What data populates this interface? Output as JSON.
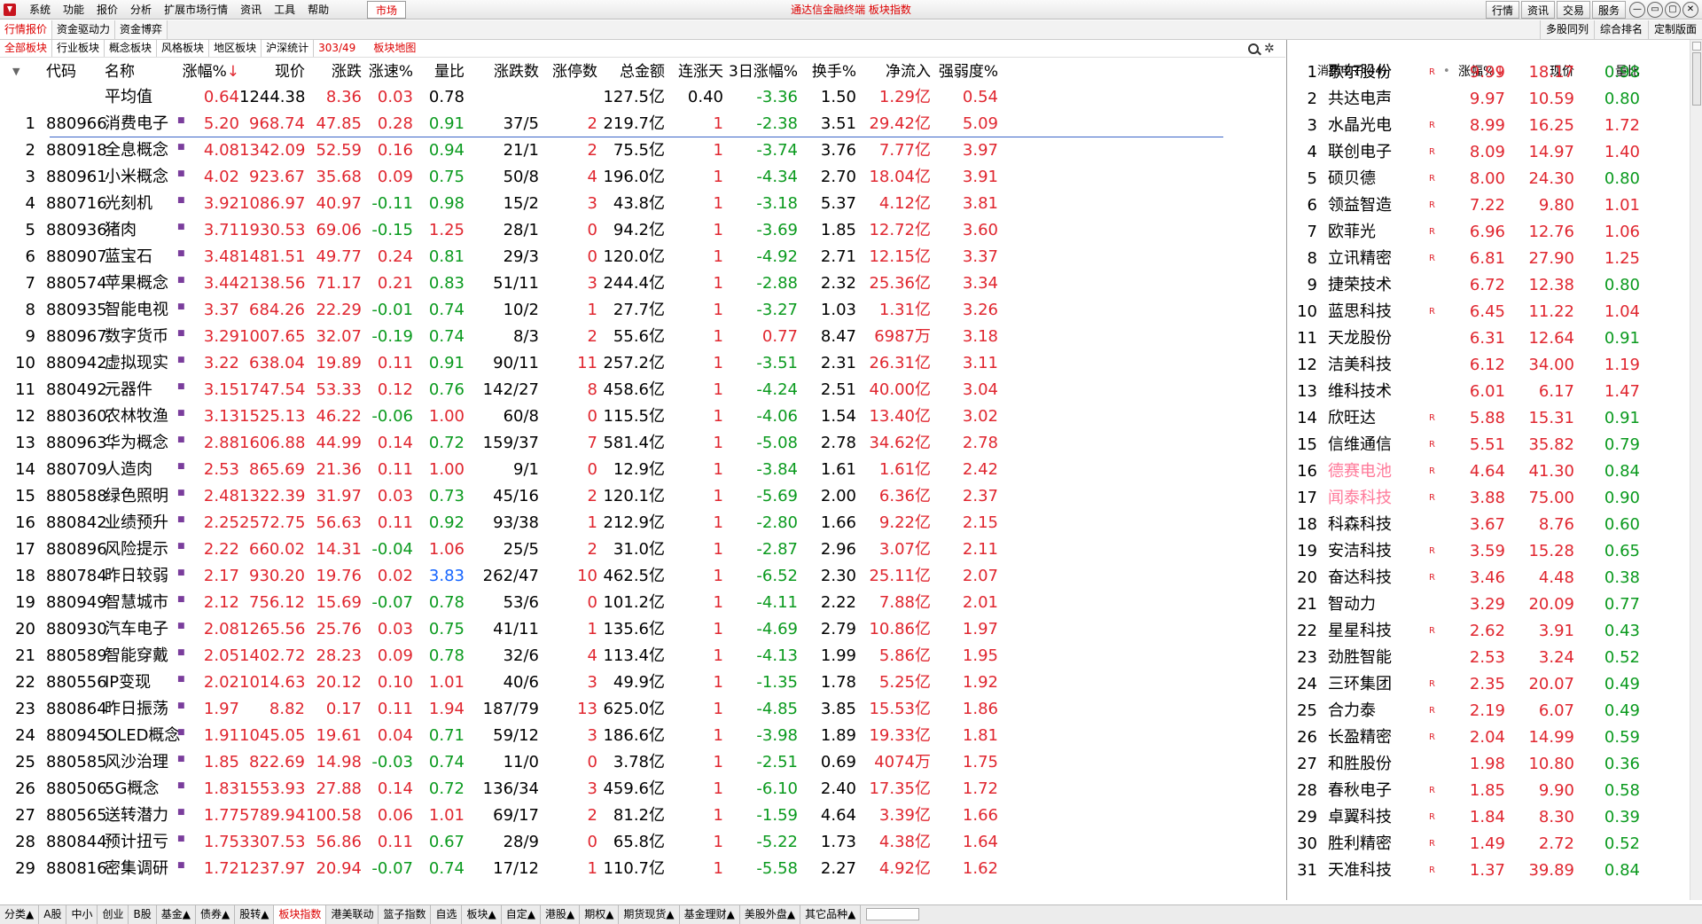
{
  "window": {
    "menu": [
      "系统",
      "功能",
      "报价",
      "分析",
      "扩展市场行情",
      "资讯",
      "工具",
      "帮助"
    ],
    "market_button": "市场",
    "title": "通达信金融终端 板块指数",
    "right_buttons": [
      "行情",
      "资讯",
      "交易",
      "服务"
    ],
    "win_controls": [
      "—",
      "▭",
      "▢",
      "✕"
    ]
  },
  "tabs_top": {
    "left": [
      "行情报价",
      "资金驱动力",
      "资金博弈"
    ],
    "right": [
      "多股同列",
      "综合排名",
      "定制版面"
    ]
  },
  "tabs_sector": [
    "全部板块",
    "行业板块",
    "概念板块",
    "风格板块",
    "地区板块",
    "沪深统计"
  ],
  "sector_count": "303/49",
  "sector_map": "板块地图",
  "left_headers": [
    "代码",
    "名称",
    "涨幅%",
    "现价",
    "涨跌",
    "涨速%",
    "量比",
    "涨跌数",
    "涨停数",
    "总金额",
    "连涨天",
    "3日涨幅%",
    "换手%",
    "净流入",
    "强弱度%"
  ],
  "avg_row": {
    "label": "平均值",
    "vals": [
      "0.64",
      "1244.38",
      "8.36",
      "0.03",
      "0.78",
      "",
      "",
      "127.5亿",
      "0.40",
      "-3.36",
      "1.50",
      "1.29亿",
      "0.54"
    ]
  },
  "rows": [
    [
      "1",
      "880966",
      "消费电子",
      "5.20",
      "968.74",
      "47.85",
      "0.28",
      "0.91",
      "37/5",
      "2",
      "219.7亿",
      "1",
      "-2.38",
      "3.51",
      "29.42亿",
      "5.09"
    ],
    [
      "2",
      "880918",
      "全息概念",
      "4.08",
      "1342.09",
      "52.59",
      "0.16",
      "0.94",
      "21/1",
      "2",
      "75.5亿",
      "1",
      "-3.74",
      "3.76",
      "7.77亿",
      "3.97"
    ],
    [
      "3",
      "880961",
      "小米概念",
      "4.02",
      "923.67",
      "35.68",
      "0.09",
      "0.75",
      "50/8",
      "4",
      "196.0亿",
      "1",
      "-4.34",
      "2.70",
      "18.04亿",
      "3.91"
    ],
    [
      "4",
      "880716",
      "光刻机",
      "3.92",
      "1086.97",
      "40.97",
      "-0.11",
      "0.98",
      "15/2",
      "3",
      "43.8亿",
      "1",
      "-3.18",
      "5.37",
      "4.12亿",
      "3.81"
    ],
    [
      "5",
      "880936",
      "猪肉",
      "3.71",
      "1930.53",
      "69.06",
      "-0.15",
      "1.25",
      "28/1",
      "0",
      "94.2亿",
      "1",
      "-3.69",
      "1.85",
      "12.72亿",
      "3.60"
    ],
    [
      "6",
      "880907",
      "蓝宝石",
      "3.48",
      "1481.51",
      "49.77",
      "0.24",
      "0.81",
      "29/3",
      "0",
      "120.0亿",
      "1",
      "-4.92",
      "2.71",
      "12.15亿",
      "3.37"
    ],
    [
      "7",
      "880574",
      "苹果概念",
      "3.44",
      "2138.56",
      "71.17",
      "0.21",
      "0.83",
      "51/11",
      "3",
      "244.4亿",
      "1",
      "-2.88",
      "2.32",
      "25.36亿",
      "3.34"
    ],
    [
      "8",
      "880935",
      "智能电视",
      "3.37",
      "684.26",
      "22.29",
      "-0.01",
      "0.74",
      "10/2",
      "1",
      "27.7亿",
      "1",
      "-3.27",
      "1.03",
      "1.31亿",
      "3.26"
    ],
    [
      "9",
      "880967",
      "数字货币",
      "3.29",
      "1007.65",
      "32.07",
      "-0.19",
      "0.74",
      "8/3",
      "2",
      "55.6亿",
      "1",
      "0.77",
      "8.47",
      "6987万",
      "3.18"
    ],
    [
      "10",
      "880942",
      "虚拟现实",
      "3.22",
      "638.04",
      "19.89",
      "0.11",
      "0.91",
      "90/11",
      "11",
      "257.2亿",
      "1",
      "-3.51",
      "2.31",
      "26.31亿",
      "3.11"
    ],
    [
      "11",
      "880492",
      "元器件",
      "3.15",
      "1747.54",
      "53.33",
      "0.12",
      "0.76",
      "142/27",
      "8",
      "458.6亿",
      "1",
      "-4.24",
      "2.51",
      "40.00亿",
      "3.04"
    ],
    [
      "12",
      "880360",
      "农林牧渔",
      "3.13",
      "1525.13",
      "46.22",
      "-0.06",
      "1.00",
      "60/8",
      "0",
      "115.5亿",
      "1",
      "-4.06",
      "1.54",
      "13.40亿",
      "3.02"
    ],
    [
      "13",
      "880963",
      "华为概念",
      "2.88",
      "1606.88",
      "44.99",
      "0.14",
      "0.72",
      "159/37",
      "7",
      "581.4亿",
      "1",
      "-5.08",
      "2.78",
      "34.62亿",
      "2.78"
    ],
    [
      "14",
      "880709",
      "人造肉",
      "2.53",
      "865.69",
      "21.36",
      "0.11",
      "1.00",
      "9/1",
      "0",
      "12.9亿",
      "1",
      "-3.84",
      "1.61",
      "1.61亿",
      "2.42"
    ],
    [
      "15",
      "880588",
      "绿色照明",
      "2.48",
      "1322.39",
      "31.97",
      "0.03",
      "0.73",
      "45/16",
      "2",
      "120.1亿",
      "1",
      "-5.69",
      "2.00",
      "6.36亿",
      "2.37"
    ],
    [
      "16",
      "880842",
      "业绩预升",
      "2.25",
      "2572.75",
      "56.63",
      "0.11",
      "0.92",
      "93/38",
      "1",
      "212.9亿",
      "1",
      "-2.80",
      "1.66",
      "9.22亿",
      "2.15"
    ],
    [
      "17",
      "880896",
      "风险提示",
      "2.22",
      "660.02",
      "14.31",
      "-0.04",
      "1.06",
      "25/5",
      "2",
      "31.0亿",
      "1",
      "-2.87",
      "2.96",
      "3.07亿",
      "2.11"
    ],
    [
      "18",
      "880784",
      "昨日较弱",
      "2.17",
      "930.20",
      "19.76",
      "0.02",
      "3.83",
      "262/47",
      "10",
      "462.5亿",
      "1",
      "-6.52",
      "2.30",
      "25.11亿",
      "2.07"
    ],
    [
      "19",
      "880949",
      "智慧城市",
      "2.12",
      "756.12",
      "15.69",
      "-0.07",
      "0.78",
      "53/6",
      "0",
      "101.2亿",
      "1",
      "-4.11",
      "2.22",
      "7.88亿",
      "2.01"
    ],
    [
      "20",
      "880930",
      "汽车电子",
      "2.08",
      "1265.56",
      "25.76",
      "0.03",
      "0.75",
      "41/11",
      "1",
      "135.6亿",
      "1",
      "-4.69",
      "2.79",
      "10.86亿",
      "1.97"
    ],
    [
      "21",
      "880589",
      "智能穿戴",
      "2.05",
      "1402.72",
      "28.23",
      "0.09",
      "0.78",
      "32/6",
      "4",
      "113.4亿",
      "1",
      "-4.13",
      "1.99",
      "5.86亿",
      "1.95"
    ],
    [
      "22",
      "880556",
      "IP变现",
      "2.02",
      "1014.63",
      "20.12",
      "0.10",
      "1.01",
      "40/6",
      "3",
      "49.9亿",
      "1",
      "-1.35",
      "1.78",
      "5.25亿",
      "1.92"
    ],
    [
      "23",
      "880864",
      "昨日振荡",
      "1.97",
      "8.82",
      "0.17",
      "0.11",
      "1.94",
      "187/79",
      "13",
      "625.0亿",
      "1",
      "-4.85",
      "3.85",
      "15.53亿",
      "1.86"
    ],
    [
      "24",
      "880945",
      "OLED概念",
      "1.91",
      "1045.05",
      "19.61",
      "0.04",
      "0.71",
      "59/12",
      "3",
      "186.6亿",
      "1",
      "-3.98",
      "1.89",
      "19.33亿",
      "1.81"
    ],
    [
      "25",
      "880585",
      "风沙治理",
      "1.85",
      "822.69",
      "14.98",
      "-0.03",
      "0.74",
      "11/0",
      "0",
      "3.78亿",
      "1",
      "-2.51",
      "0.69",
      "4074万",
      "1.75"
    ],
    [
      "26",
      "880506",
      "5G概念",
      "1.83",
      "1553.93",
      "27.88",
      "0.14",
      "0.72",
      "136/34",
      "3",
      "459.6亿",
      "1",
      "-6.10",
      "2.40",
      "17.35亿",
      "1.72"
    ],
    [
      "27",
      "880565",
      "送转潜力",
      "1.77",
      "5789.94",
      "100.58",
      "0.06",
      "1.01",
      "69/17",
      "2",
      "81.2亿",
      "1",
      "-1.59",
      "4.64",
      "3.39亿",
      "1.66"
    ],
    [
      "28",
      "880844",
      "预计扭亏",
      "1.75",
      "3307.53",
      "56.86",
      "0.11",
      "0.67",
      "28/9",
      "0",
      "65.8亿",
      "1",
      "-5.22",
      "1.73",
      "4.38亿",
      "1.64"
    ],
    [
      "29",
      "880816",
      "密集调研",
      "1.72",
      "1237.97",
      "20.94",
      "-0.07",
      "0.74",
      "17/12",
      "1",
      "110.7亿",
      "1",
      "-5.58",
      "2.27",
      "4.92亿",
      "1.62"
    ]
  ],
  "right_title": "消费电子(44)",
  "right_headers": [
    "涨幅%",
    "现价",
    "量比"
  ],
  "right_rows": [
    [
      "1",
      "歌尔股份",
      "R",
      "9.99",
      "18.17",
      "0.98"
    ],
    [
      "2",
      "共达电声",
      "",
      "9.97",
      "10.59",
      "0.80"
    ],
    [
      "3",
      "水晶光电",
      "R",
      "8.99",
      "16.25",
      "1.72"
    ],
    [
      "4",
      "联创电子",
      "R",
      "8.09",
      "14.97",
      "1.40"
    ],
    [
      "5",
      "硕贝德",
      "R",
      "8.00",
      "24.30",
      "0.80"
    ],
    [
      "6",
      "领益智造",
      "R",
      "7.22",
      "9.80",
      "1.01"
    ],
    [
      "7",
      "欧菲光",
      "R",
      "6.96",
      "12.76",
      "1.06"
    ],
    [
      "8",
      "立讯精密",
      "R",
      "6.81",
      "27.90",
      "1.25"
    ],
    [
      "9",
      "捷荣技术",
      "",
      "6.72",
      "12.38",
      "0.80"
    ],
    [
      "10",
      "蓝思科技",
      "R",
      "6.45",
      "11.22",
      "1.04"
    ],
    [
      "11",
      "天龙股份",
      "",
      "6.31",
      "12.64",
      "0.91"
    ],
    [
      "12",
      "洁美科技",
      "",
      "6.12",
      "34.00",
      "1.19"
    ],
    [
      "13",
      "维科技术",
      "",
      "6.01",
      "6.17",
      "1.47"
    ],
    [
      "14",
      "欣旺达",
      "R",
      "5.88",
      "15.31",
      "0.91"
    ],
    [
      "15",
      "信维通信",
      "R",
      "5.51",
      "35.82",
      "0.79"
    ],
    [
      "16",
      "德赛电池",
      "R",
      "4.64",
      "41.30",
      "0.84"
    ],
    [
      "17",
      "闻泰科技",
      "R",
      "3.88",
      "75.00",
      "0.90"
    ],
    [
      "18",
      "科森科技",
      "",
      "3.67",
      "8.76",
      "0.60"
    ],
    [
      "19",
      "安洁科技",
      "R",
      "3.59",
      "15.28",
      "0.65"
    ],
    [
      "20",
      "奋达科技",
      "R",
      "3.46",
      "4.48",
      "0.38"
    ],
    [
      "21",
      "智动力",
      "",
      "3.29",
      "20.09",
      "0.77"
    ],
    [
      "22",
      "星星科技",
      "R",
      "2.62",
      "3.91",
      "0.43"
    ],
    [
      "23",
      "劲胜智能",
      "",
      "2.53",
      "3.24",
      "0.52"
    ],
    [
      "24",
      "三环集团",
      "R",
      "2.35",
      "20.07",
      "0.49"
    ],
    [
      "25",
      "合力泰",
      "R",
      "2.19",
      "6.07",
      "0.49"
    ],
    [
      "26",
      "长盈精密",
      "R",
      "2.04",
      "14.99",
      "0.59"
    ],
    [
      "27",
      "和胜股份",
      "",
      "1.98",
      "10.80",
      "0.36"
    ],
    [
      "28",
      "春秋电子",
      "R",
      "1.85",
      "9.90",
      "0.58"
    ],
    [
      "29",
      "卓翼科技",
      "R",
      "1.84",
      "8.30",
      "0.39"
    ],
    [
      "30",
      "胜利精密",
      "R",
      "1.49",
      "2.72",
      "0.52"
    ],
    [
      "31",
      "天准科技",
      "R",
      "1.37",
      "39.89",
      "0.84"
    ]
  ],
  "bottom_tabs": [
    "分类▲",
    "A股",
    "中小",
    "创业",
    "B股",
    "基金▲",
    "债券▲",
    "股转▲",
    "板块指数",
    "港美联动",
    "篮子指数",
    "自选",
    "板块▲",
    "自定▲",
    "港股▲",
    "期权▲",
    "期货现货▲",
    "基金理财▲",
    "美股外盘▲",
    "其它品种▲"
  ],
  "colors": {
    "up": "#e0262f",
    "down": "#0a9a1e",
    "accent": "#d00000",
    "highlight": "#1565ff"
  }
}
